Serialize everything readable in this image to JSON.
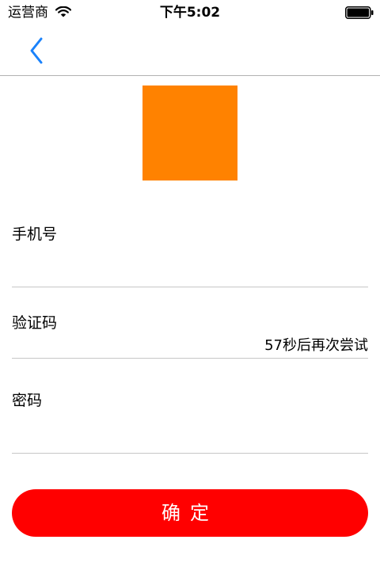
{
  "status_bar": {
    "carrier": "运营商",
    "time": "下午5:02",
    "icons": [
      "wifi-icon",
      "battery-icon"
    ]
  },
  "nav": {
    "back_icon": "chevron-left-icon",
    "accent_color": "#1a82fb"
  },
  "logo": {
    "color": "#ff8200"
  },
  "form": {
    "phone_label": "手机号",
    "code_label": "验证码",
    "countdown": "57秒后再次尝试",
    "password_label": "密码",
    "confirm_label": "确定",
    "confirm_color": "#ff0000"
  }
}
